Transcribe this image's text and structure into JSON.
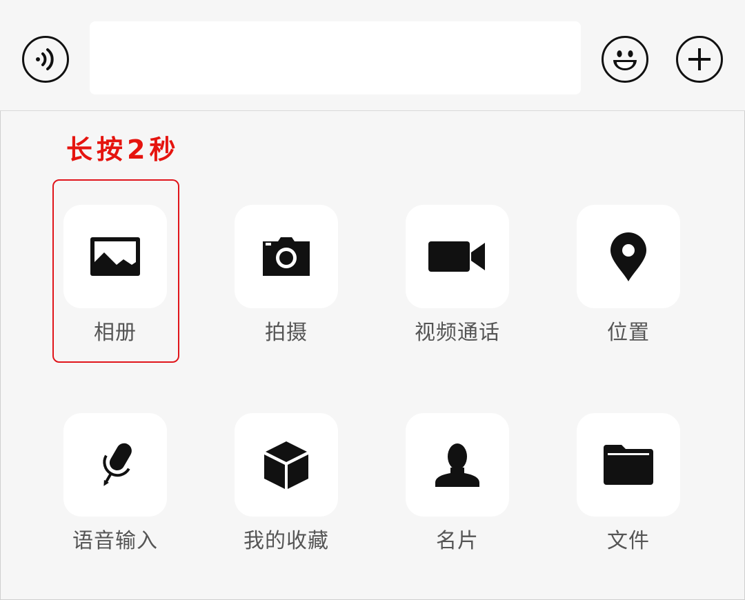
{
  "hint": "长按2秒",
  "toolbar": {
    "voice_icon": "voice-icon",
    "emoji_icon": "emoji-icon",
    "plus_icon": "plus-icon",
    "input_value": ""
  },
  "panel": {
    "items": [
      {
        "label": "相册",
        "icon": "photo-icon"
      },
      {
        "label": "拍摄",
        "icon": "camera-icon"
      },
      {
        "label": "视频通话",
        "icon": "video-call-icon"
      },
      {
        "label": "位置",
        "icon": "location-icon"
      },
      {
        "label": "语音输入",
        "icon": "microphone-icon"
      },
      {
        "label": "我的收藏",
        "icon": "favorites-icon"
      },
      {
        "label": "名片",
        "icon": "contact-card-icon"
      },
      {
        "label": "文件",
        "icon": "folder-icon"
      }
    ]
  },
  "colors": {
    "hint": "#e5140f",
    "highlight_border": "#e0141a",
    "background": "#f6f6f6",
    "tile": "#ffffff",
    "icon": "#111111",
    "label": "#555555"
  }
}
